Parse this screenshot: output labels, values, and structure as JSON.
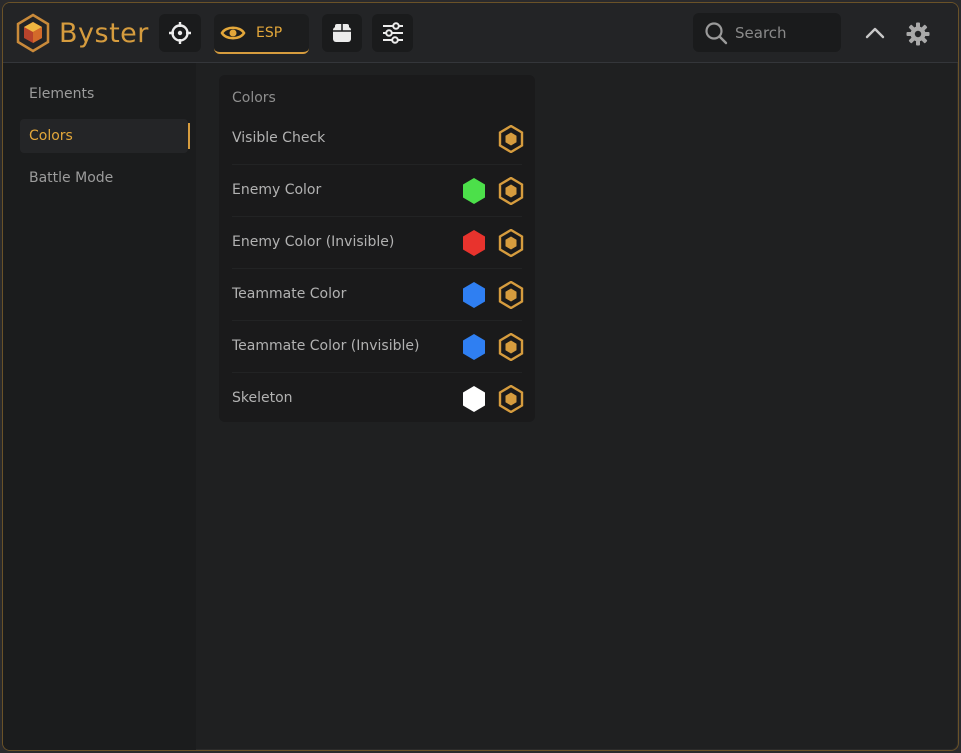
{
  "app": {
    "name": "Byster"
  },
  "toolbar": {
    "tabs": [
      {
        "icon": "crosshair-icon"
      },
      {
        "icon": "eye-icon",
        "label": "ESP",
        "active": true
      },
      {
        "icon": "box-icon"
      },
      {
        "icon": "sliders-icon"
      }
    ],
    "search_placeholder": "Search",
    "collapse_icon": "chevron-up-icon",
    "settings_icon": "gear-icon"
  },
  "sidebar": {
    "items": [
      {
        "label": "Elements",
        "active": false
      },
      {
        "label": "Colors",
        "active": true
      },
      {
        "label": "Battle Mode",
        "active": false
      }
    ]
  },
  "panel": {
    "title": "Colors",
    "rows": [
      {
        "label": "Visible Check",
        "color": null
      },
      {
        "label": "Enemy Color",
        "color": "#4ce04a"
      },
      {
        "label": "Enemy Color (Invisible)",
        "color": "#e8332d"
      },
      {
        "label": "Teammate Color",
        "color": "#2f7ff2"
      },
      {
        "label": "Teammate Color (Invisible)",
        "color": "#2f7ff2"
      },
      {
        "label": "Skeleton",
        "color": "#ffffff"
      }
    ]
  },
  "colors": {
    "accent": "#d69c3e",
    "background": "#1f2021"
  }
}
